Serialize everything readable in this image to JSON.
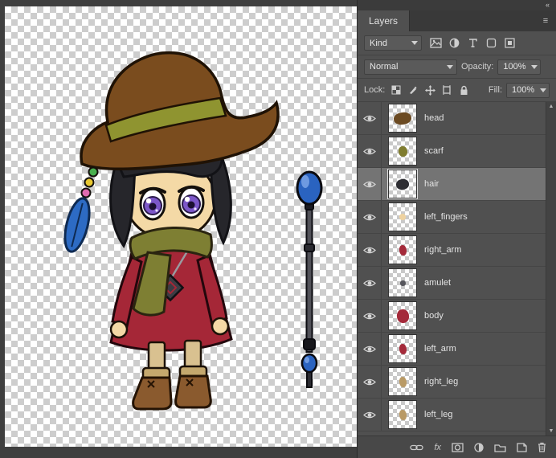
{
  "window": {
    "collapse_icon": "«",
    "panel_menu_icon": "≡",
    "scroll_up_icon": "▲",
    "scroll_down_icon": "▼"
  },
  "layers_panel": {
    "tab_label": "Layers",
    "filter": {
      "kind_label": "Kind",
      "filter_icons": [
        "pixel-layers-filter",
        "adjustment-layers-filter",
        "type-layers-filter",
        "shape-layers-filter",
        "smart-object-filter"
      ]
    },
    "blend_mode": "Normal",
    "opacity_label": "Opacity:",
    "opacity_value": "100%",
    "lock_label": "Lock:",
    "lock_icons": [
      "lock-transparent-pixels",
      "lock-image-pixels",
      "lock-position",
      "lock-artboard",
      "lock-all"
    ],
    "fill_label": "Fill:",
    "fill_value": "100%",
    "layers": [
      {
        "name": "head",
        "selected": false,
        "blob_color": "#6b4a22",
        "blob_w": 22,
        "blob_h": 15
      },
      {
        "name": "scarf",
        "selected": false,
        "blob_color": "#7f7c2f",
        "blob_w": 11,
        "blob_h": 13
      },
      {
        "name": "hair",
        "selected": true,
        "blob_color": "#2e2e33",
        "blob_w": 16,
        "blob_h": 13
      },
      {
        "name": "left_fingers",
        "selected": false,
        "blob_color": "#eed2a0",
        "blob_w": 8,
        "blob_h": 8
      },
      {
        "name": "right_arm",
        "selected": false,
        "blob_color": "#a42a3a",
        "blob_w": 9,
        "blob_h": 13
      },
      {
        "name": "amulet",
        "selected": false,
        "blob_color": "#56565c",
        "blob_w": 7,
        "blob_h": 7
      },
      {
        "name": "body",
        "selected": false,
        "blob_color": "#a42a3a",
        "blob_w": 15,
        "blob_h": 17
      },
      {
        "name": "left_arm",
        "selected": false,
        "blob_color": "#a42a3a",
        "blob_w": 9,
        "blob_h": 13
      },
      {
        "name": "right_leg",
        "selected": false,
        "blob_color": "#b99a66",
        "blob_w": 9,
        "blob_h": 13
      },
      {
        "name": "left_leg",
        "selected": false,
        "blob_color": "#b99a66",
        "blob_w": 9,
        "blob_h": 13
      }
    ],
    "bottom_bar": {
      "fx_label": "fx",
      "icons": [
        "link-layers",
        "layer-effects",
        "add-layer-mask",
        "new-adjustment-layer",
        "new-group",
        "new-layer",
        "delete-layer"
      ]
    }
  },
  "art": {
    "hat_color": "#7a4c1e",
    "hat_band_color": "#8f9430",
    "hair_color": "#26262b",
    "skin_color": "#f4d9a6",
    "eye_iris_color": "#7c57c8",
    "dress_color": "#a52737",
    "scarf_color": "#7e7f33",
    "leggings_color": "#d9c190",
    "boot_color": "#8a5a2e",
    "feather_color": "#2d6bc4",
    "staff_orb_color": "#2a63c0"
  }
}
